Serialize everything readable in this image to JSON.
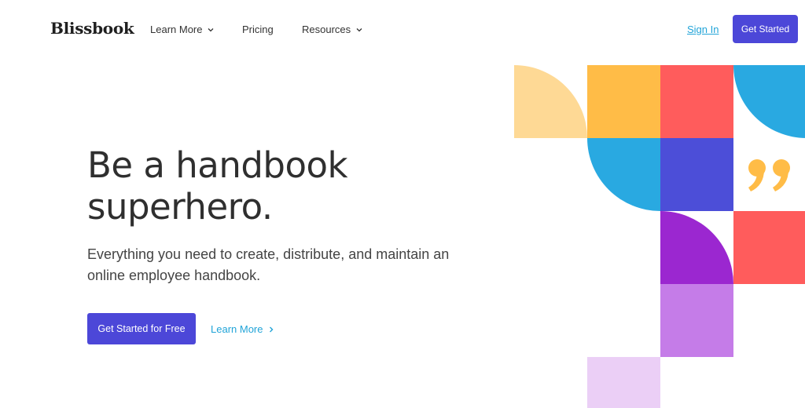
{
  "header": {
    "logo": "Blissbook",
    "nav": [
      {
        "label": "Learn More",
        "dropdown": true
      },
      {
        "label": "Pricing",
        "dropdown": false
      },
      {
        "label": "Resources",
        "dropdown": true
      }
    ],
    "sign_in": "Sign In",
    "get_started": "Get Started"
  },
  "hero": {
    "title_line1": "Be a handbook",
    "title_line2": "superhero.",
    "subtitle_line1": "Everything you need to create, distribute, and maintain an",
    "subtitle_line2": "online employee handbook.",
    "primary_cta": "Get Started for Free",
    "secondary_cta": "Learn More"
  },
  "art": {
    "colors": {
      "peach": "#fed995",
      "orange": "#ffbc47",
      "coral": "#ff5c5c",
      "blue": "#29a9e1",
      "indigo": "#4c4ed8",
      "purple": "#9b27d0",
      "lavender": "#c57ce8",
      "pale_lavender": "#ebcff6"
    },
    "quote_mark": "”"
  },
  "theme": {
    "accent": "#4c47d8",
    "link": "#21a4d8"
  }
}
